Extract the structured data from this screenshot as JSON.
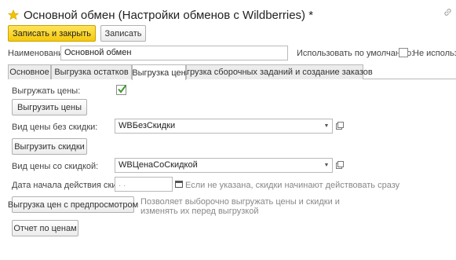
{
  "window": {
    "title": "Основной обмен (Настройки обменов с Wildberries) *",
    "favorite_icon": "star-icon",
    "link_icon": "link-icon"
  },
  "toolbar": {
    "save_close_label": "Записать и закрыть",
    "save_label": "Записать"
  },
  "form": {
    "name_label": "Наименование:",
    "name_value": "Основной обмен",
    "default_label": "Использовать по умолчанию:",
    "default_checked": false,
    "noprefix_label": "Не использов"
  },
  "tabs": [
    {
      "label": "Основное",
      "active": false
    },
    {
      "label": "Выгрузка остатков",
      "active": false
    },
    {
      "label": "Выгрузка цен",
      "active": true
    },
    {
      "label": "Загрузка сборочных заданий и создание заказов",
      "active": false
    }
  ],
  "prices": {
    "upload_prices_label": "Выгружать цены:",
    "upload_prices_checked": true,
    "upload_prices_button": "Выгрузить цены",
    "price_no_discount_label": "Вид цены без скидки:",
    "price_no_discount_value": "WBБезСкидки",
    "upload_discounts_button": "Выгрузить скидки",
    "price_with_discount_label": "Вид цены со скидкой:",
    "price_with_discount_value": "WBЦенаСоСкидкой",
    "discount_start_label": "Дата начала действия скидок:",
    "discount_start_placeholder": " .  .",
    "discount_start_hint": "Если не указана, скидки начинают действовать сразу",
    "preview_button": "Выгрузка цен с предпросмотром",
    "preview_hint": "Позволяет выборочно выгружать цены и скидки и изменять их перед выгрузкой",
    "report_button": "Отчет по ценам"
  },
  "colors": {
    "accent": "#f6c90c",
    "check": "#3a9a2a"
  }
}
